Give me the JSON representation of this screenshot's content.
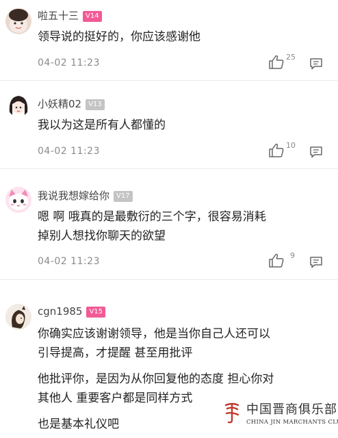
{
  "comments": [
    {
      "username": "啦五十三",
      "level": "V14",
      "lines": [
        "领导说的挺好的，你应该感谢他"
      ],
      "time": "04-02 11:23",
      "likes": "25",
      "level_color": "#f25a96"
    },
    {
      "username": "小妖精02",
      "level": "V13",
      "lines": [
        "我以为这是所有人都懂的"
      ],
      "time": "04-02 11:23",
      "likes": "10",
      "level_color": "#c4c4c4"
    },
    {
      "username": "我说我想嫁给你",
      "level": "V17",
      "lines": [
        "嗯 啊 哦真的是最敷衍的三个字，很容易消耗",
        "掉别人想找你聊天的欲望"
      ],
      "time": "04-02 11:23",
      "likes": "9",
      "level_color": "#c4c4c4"
    },
    {
      "username": "cgn1985",
      "level": "V15",
      "lines": [
        "你确实应该谢谢领导，他是当你自己人还可以",
        "引导提高，才提醒 甚至用批评",
        "他批评你，是因为从你回复他的态度 担心你对",
        "其他人 重要客户都是同样方式",
        "也是基本礼仪吧"
      ],
      "level_color": "#f25a96"
    }
  ],
  "icons": {
    "like": "thumbs-up-icon",
    "reply": "comment-icon"
  },
  "watermark": {
    "cn": "中国晋商俱乐部",
    "en": "CHINA JIN MARCHANTS CLUB",
    "color": "#c0392b"
  }
}
